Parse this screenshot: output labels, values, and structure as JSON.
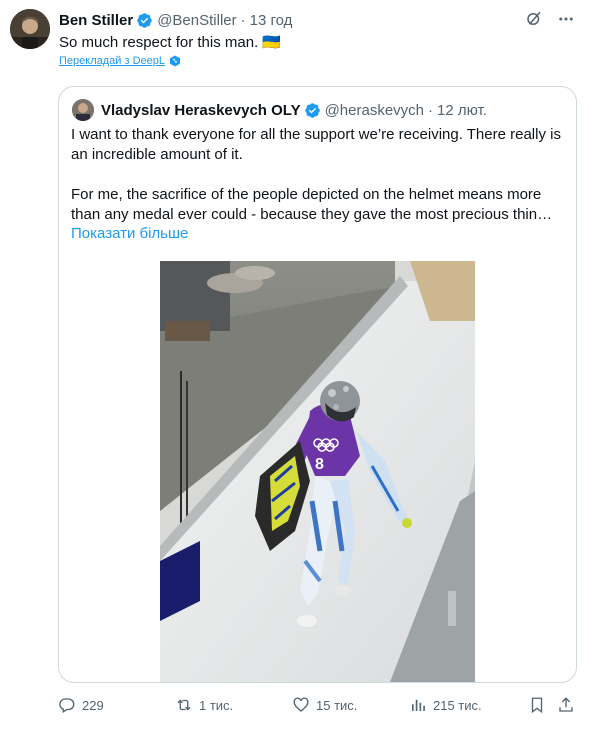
{
  "tweet": {
    "author_name": "Ben Stiller",
    "handle": "@BenStiller",
    "time": "13 год",
    "text": "So much respect for this man. 🇺🇦",
    "translate_label": "Перекладай з DeepL"
  },
  "quote": {
    "author_name": "Vladyslav Heraskevych OLY",
    "handle": "@heraskevych",
    "time": "12 лют.",
    "paragraph1": "I want to thank everyone for all the support we’re receiving. There really is an incredible amount of it.",
    "paragraph2": "For me, the sacrifice of the people depicted on the helmet means more than any medal ever could - because they gave the most precious thin…",
    "show_more": "Показати більше",
    "photo_bib": "8"
  },
  "actions": {
    "replies": "229",
    "reposts": "1 тис.",
    "likes": "15 тис.",
    "views": "215 тис."
  },
  "colors": {
    "accent": "#1d9bf0",
    "muted": "#536471",
    "border": "#cfd9de"
  }
}
